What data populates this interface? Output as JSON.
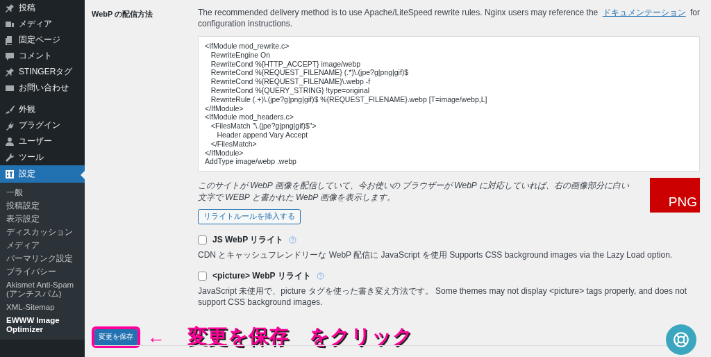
{
  "sidebar": {
    "items": [
      {
        "label": "投稿",
        "selected": false
      },
      {
        "label": "メディア",
        "selected": false
      },
      {
        "label": "固定ページ",
        "selected": false
      },
      {
        "label": "コメント",
        "selected": false
      },
      {
        "label": "STINGERタグ",
        "selected": false
      },
      {
        "label": "お問い合わせ",
        "selected": false
      },
      {
        "label": "外観",
        "selected": false
      },
      {
        "label": "プラグイン",
        "selected": false
      },
      {
        "label": "ユーザー",
        "selected": false
      },
      {
        "label": "ツール",
        "selected": false
      },
      {
        "label": "設定",
        "selected": true,
        "children": [
          {
            "label": "一般",
            "selected": false
          },
          {
            "label": "投稿設定",
            "selected": false
          },
          {
            "label": "表示設定",
            "selected": false
          },
          {
            "label": "ディスカッション",
            "selected": false
          },
          {
            "label": "メディア",
            "selected": false
          },
          {
            "label": "パーマリンク設定",
            "selected": false
          },
          {
            "label": "プライバシー",
            "selected": false
          },
          {
            "label": "Akismet Anti-Spam (アンチスパム)",
            "selected": false
          },
          {
            "label": "XML-Sitemap",
            "selected": false
          },
          {
            "label": "EWWW Image Optimizer",
            "selected": true
          }
        ]
      }
    ]
  },
  "setting": {
    "label": "WebP の配信方法",
    "description": "The recommended delivery method is to use Apache/LiteSpeed rewrite rules. Nginx users may reference the ",
    "link": "ドキュメンテーション",
    "description_end": " for configuration instructions.",
    "code": "<IfModule mod_rewrite.c>\n\tRewriteEngine On\n\tRewriteCond %{HTTP_ACCEPT} image/webp\n\tRewriteCond %{REQUEST_FILENAME} (.*)\\.(jpe?g|png|gif)$\n\tRewriteCond %{REQUEST_FILENAME}\\.webp -f\n\tRewriteCond %{QUERY_STRING} !type=original\n\tRewriteRule (.+)\\.(jpe?g|png|gif)$ %{REQUEST_FILENAME}.webp [T=image/webp,L]\n</IfModule>\n<IfModule mod_headers.c>\n\t<FilesMatch \"\\.(jpe?g|png|gif)$\">\n\t\tHeader append Vary Accept\n\t</FilesMatch>\n</IfModule>\nAddType image/webp .webp",
    "note": "このサイトが WebP 画像を配信していて、今お使いの ブラウザーが WebP に対応していれば、右の画像部分に白い文字で WEBP と書かれた WebP 画像を表示します。",
    "sample_image": "PNG",
    "button": "リライトルールを挿入する"
  },
  "options": [
    {
      "label": "JS WebP リライト",
      "checked": false,
      "description": "CDN とキャッシュフレンドリーな WebP 配信に JavaScript を使用 Supports CSS background images via the Lazy Load option."
    },
    {
      "label": "<picture> WebP リライト",
      "checked": false,
      "description": "JavaScript 未使用で、picture タグを使った書き変え方法です。 Some themes may not display <picture> tags properly, and does not support CSS background images."
    }
  ],
  "save_button": "変更を保存",
  "annotation": {
    "arrow": "←",
    "text": "変更を保存　をクリック"
  }
}
